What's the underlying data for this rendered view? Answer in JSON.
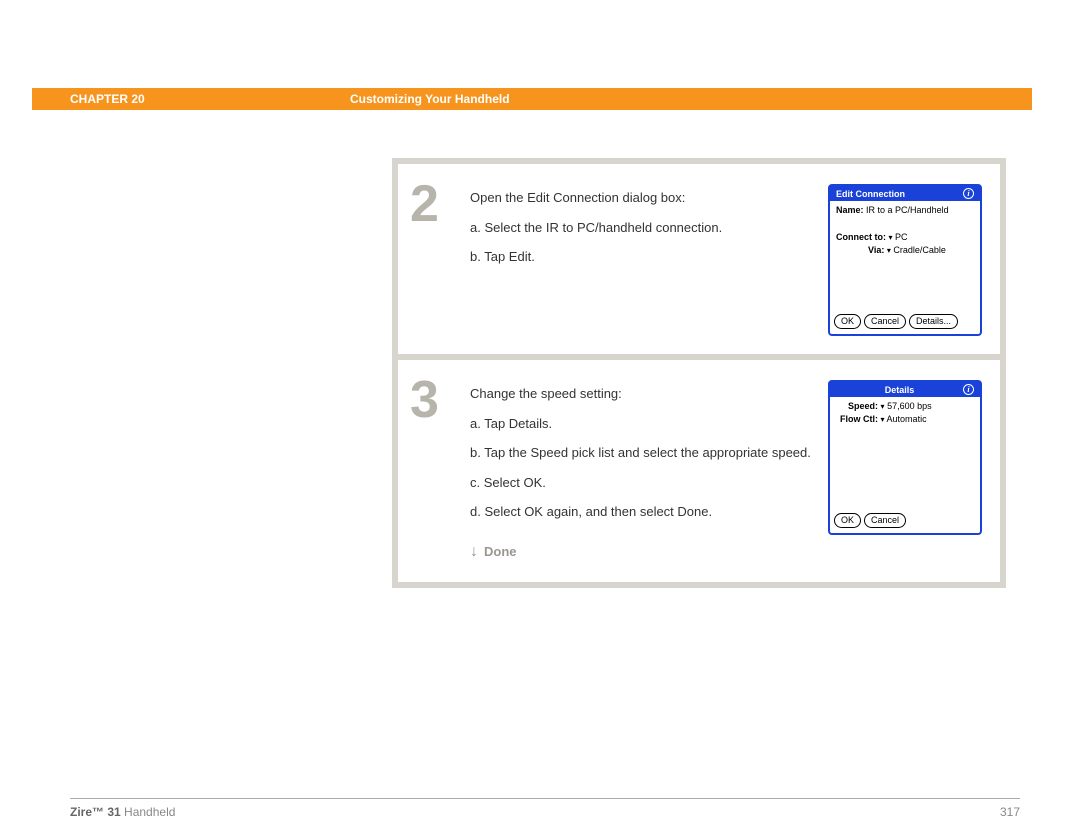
{
  "header": {
    "chapter": "CHAPTER 20",
    "title": "Customizing Your Handheld"
  },
  "steps": [
    {
      "number": "2",
      "intro": "Open the Edit Connection dialog box:",
      "items": [
        "a. Select the IR to PC/handheld connection.",
        "b. Tap Edit."
      ],
      "screen": {
        "title": "Edit Connection",
        "name_label": "Name:",
        "name_value": "IR to a PC/Handheld",
        "connect_label": "Connect to:",
        "connect_value": "PC",
        "via_label": "Via:",
        "via_value": "Cradle/Cable",
        "buttons": [
          "OK",
          "Cancel",
          "Details..."
        ]
      }
    },
    {
      "number": "3",
      "intro": "Change the speed setting:",
      "items": [
        "a. Tap Details.",
        "b. Tap the Speed pick list and select the appropriate speed.",
        "c. Select OK.",
        "d. Select OK again, and then select Done."
      ],
      "done": "Done",
      "screen": {
        "title": "Details",
        "speed_label": "Speed:",
        "speed_value": "57,600 bps",
        "flow_label": "Flow Ctl:",
        "flow_value": "Automatic",
        "buttons": [
          "OK",
          "Cancel"
        ]
      }
    }
  ],
  "footer": {
    "product_bold": "Zire™ 31",
    "product_rest": " Handheld",
    "page": "317"
  }
}
